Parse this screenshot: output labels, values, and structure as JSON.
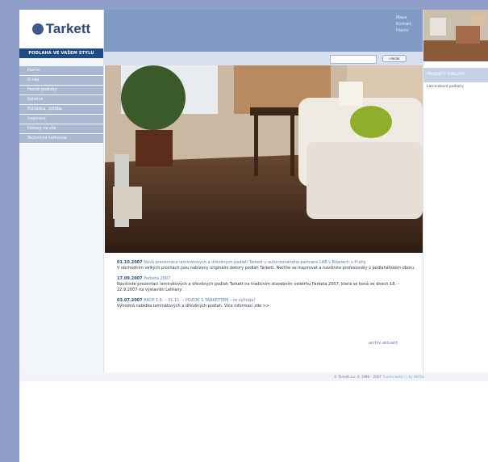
{
  "brand": {
    "logo_text": "Tarkett",
    "slogan": "PODLAHA VE VAŠEM STYLU"
  },
  "header": {
    "links": [
      "Mapa",
      "Kontakt",
      "Hlavní"
    ]
  },
  "search": {
    "placeholder": "",
    "button_label": "Hledat"
  },
  "sidebar": {
    "items": [
      {
        "label": "Home"
      },
      {
        "label": "O nás"
      },
      {
        "label": "Pevné podlahy"
      },
      {
        "label": "Kolekce"
      },
      {
        "label": "Pokládka, údržba"
      },
      {
        "label": "Inspirace"
      },
      {
        "label": "Dotazy na vše"
      },
      {
        "label": "Technická knihovna"
      }
    ]
  },
  "news": [
    {
      "date": "01.10.2007",
      "title": "Nová prezentace laminátových a dřevěných podlah Tarkett u autorizovaného partnera LAB v Bílanech u Prahy",
      "body": "V obchodním velkých plochách jsou nabízeny originální dekory podlah Tarkett. Nechte se inspirovat a navštivte profesionály v podlahářském oboru."
    },
    {
      "date": "17.09.2007",
      "title": "Parketa 2007",
      "body": "Navštivte prezentaci laminátových a dřevěných podlah Tarkett na tradičním stavebním veletrhu Parketa 2007, která se koná ve dnech 18. – 22.9.2007 na výstavišti Letňany."
    },
    {
      "date": "03.07.2007",
      "title": "AKCE 1.6. – 31.11. – POZOR S TARKETTEM – to vyhraje!",
      "body": "Výhodná nabídka laminátových a dřevěných podlah. Více informací zde >>"
    }
  ],
  "news_archive_label": "archiv aktualit",
  "right_panel": {
    "heading": "PRODUKTY PODLAHY",
    "item": "Laminátové podlahy"
  },
  "footer": {
    "copyright": "© Tarkett a.s. © 1996 – 2007",
    "credit": "Tvorba webů | |   by ANTEK"
  },
  "colors": {
    "page_bg": "#8e9ec9",
    "brand_blue": "#1f4b86",
    "header_blue": "#7f9bc3",
    "nav_bg": "#aab8d2"
  }
}
